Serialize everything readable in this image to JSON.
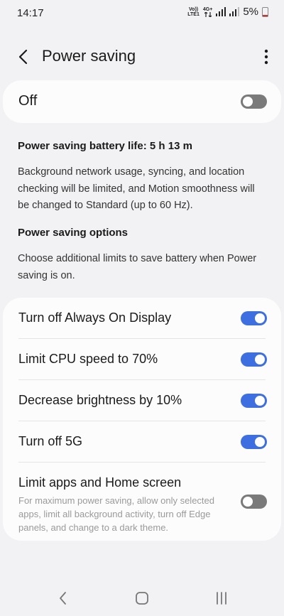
{
  "status": {
    "time": "14:17",
    "volte_top": "Vo))",
    "volte_bottom": "LTE1",
    "net_top": "4G+",
    "battery_pct": "5%"
  },
  "header": {
    "title": "Power saving"
  },
  "master": {
    "label": "Off",
    "state": "off"
  },
  "info": {
    "battery_life": "Power saving battery life: 5 h 13 m",
    "description": "Background network usage, syncing, and location checking will be limited, and Motion smoothness will be changed to Standard (up to 60 Hz).",
    "options_heading": "Power saving options",
    "options_description": "Choose additional limits to save battery when Power saving is on."
  },
  "options": [
    {
      "label": "Turn off Always On Display",
      "state": "on"
    },
    {
      "label": "Limit CPU speed to 70%",
      "state": "on"
    },
    {
      "label": "Decrease brightness by 10%",
      "state": "on"
    },
    {
      "label": "Turn off 5G",
      "state": "on"
    },
    {
      "label": "Limit apps and Home screen",
      "state": "off",
      "sub": "For maximum power saving, allow only selected apps, limit all background activity, turn off Edge panels, and change to a dark theme."
    }
  ],
  "colors": {
    "toggle_on": "#3d6fe0",
    "toggle_off": "#7a7a7a",
    "background": "#f2f2f4"
  }
}
